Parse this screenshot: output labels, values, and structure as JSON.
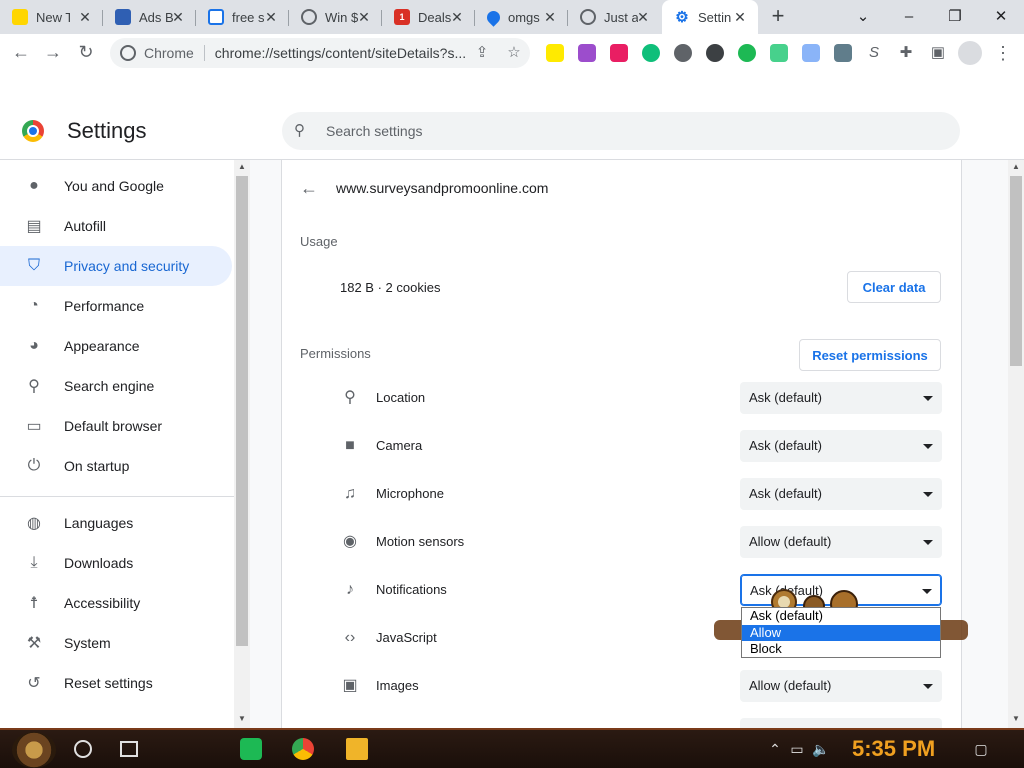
{
  "tabs": [
    {
      "title": "New T",
      "fav_color": "#ffd600"
    },
    {
      "title": "Ads B",
      "fav_color": "#2f5fb3"
    },
    {
      "title": "free s",
      "fav_color": "#e0e0e0"
    },
    {
      "title": "Win $",
      "fav_color": "#5f6368"
    },
    {
      "title": "Deals",
      "fav_color": "#d93025",
      "fav_text": "1"
    },
    {
      "title": "omgs",
      "fav_color": "#1a73e8"
    },
    {
      "title": "Just a",
      "fav_color": "#5f6368"
    },
    {
      "title": "Settin",
      "fav_color": "#1a73e8",
      "active": true
    }
  ],
  "toolbar": {
    "chrome_label": "Chrome",
    "url": "chrome://settings/content/siteDetails?s..."
  },
  "header": {
    "title": "Settings",
    "search_placeholder": "Search settings"
  },
  "sidebar": {
    "items": [
      {
        "label": "You and Google",
        "icon": "person-icon"
      },
      {
        "label": "Autofill",
        "icon": "clipboard-icon"
      },
      {
        "label": "Privacy and security",
        "icon": "shield-icon",
        "active": true
      },
      {
        "label": "Performance",
        "icon": "gauge-icon"
      },
      {
        "label": "Appearance",
        "icon": "palette-icon"
      },
      {
        "label": "Search engine",
        "icon": "search-icon"
      },
      {
        "label": "Default browser",
        "icon": "browser-icon"
      },
      {
        "label": "On startup",
        "icon": "power-icon"
      },
      {
        "label": "Languages",
        "icon": "globe-icon"
      },
      {
        "label": "Downloads",
        "icon": "download-icon"
      },
      {
        "label": "Accessibility",
        "icon": "accessibility-icon"
      },
      {
        "label": "System",
        "icon": "wrench-icon"
      },
      {
        "label": "Reset settings",
        "icon": "reset-icon"
      }
    ]
  },
  "main": {
    "site": "www.surveysandpromoonline.com",
    "usage_heading": "Usage",
    "usage_value": "182 B · 2 cookies",
    "clear_data": "Clear data",
    "permissions_heading": "Permissions",
    "reset_permissions": "Reset permissions",
    "permissions": [
      {
        "label": "Location",
        "value": "Ask (default)",
        "icon": "location-pin-icon"
      },
      {
        "label": "Camera",
        "value": "Ask (default)",
        "icon": "camera-icon"
      },
      {
        "label": "Microphone",
        "value": "Ask (default)",
        "icon": "microphone-icon"
      },
      {
        "label": "Motion sensors",
        "value": "Allow (default)",
        "icon": "motion-sensor-icon"
      },
      {
        "label": "Notifications",
        "value": "Ask (default)",
        "icon": "bell-icon",
        "open": true
      },
      {
        "label": "JavaScript",
        "value": "",
        "icon": "code-icon"
      },
      {
        "label": "Images",
        "value": "Allow (default)",
        "icon": "image-icon"
      }
    ],
    "dropdown_options": [
      "Ask (default)",
      "Allow",
      "Block"
    ],
    "dropdown_highlighted": 1
  },
  "taskbar": {
    "clock": "5:35 PM"
  },
  "colors": {
    "accent": "#1a73e8",
    "nav_active_bg": "#e8f0fe",
    "clock": "#f0a020"
  }
}
